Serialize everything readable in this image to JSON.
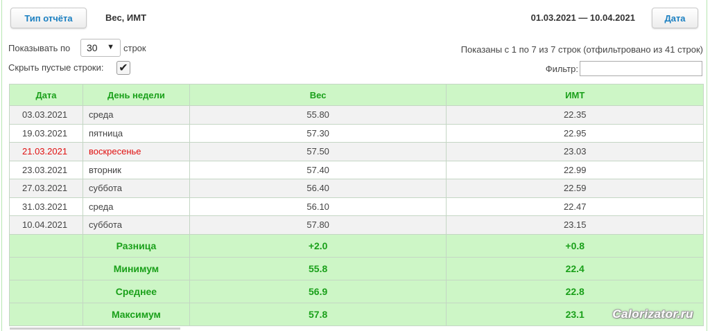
{
  "header": {
    "report_type_button": "Тип отчёта",
    "report_title": "Вес, ИМТ",
    "date_range": "01.03.2021 — 10.04.2021",
    "date_button": "Дата"
  },
  "controls": {
    "show_prefix": "Показывать по",
    "rows_per_page": "30",
    "show_suffix": "строк",
    "hide_empty_label": "Скрыть пустые строки:",
    "hide_empty_checked": "✔",
    "info_text": "Показаны с 1 по 7 из 7 строк (отфильтровано из 41 строк)",
    "filter_label": "Фильтр:",
    "filter_value": ""
  },
  "table": {
    "columns": [
      "Дата",
      "День недели",
      "Вес",
      "ИМТ"
    ],
    "rows": [
      {
        "date": "03.03.2021",
        "day": "среда",
        "weight": "55.80",
        "bmi": "22.35"
      },
      {
        "date": "19.03.2021",
        "day": "пятница",
        "weight": "57.30",
        "bmi": "22.95"
      },
      {
        "date": "21.03.2021",
        "day": "воскресенье",
        "weight": "57.50",
        "bmi": "23.03"
      },
      {
        "date": "23.03.2021",
        "day": "вторник",
        "weight": "57.40",
        "bmi": "22.99"
      },
      {
        "date": "27.03.2021",
        "day": "суббота",
        "weight": "56.40",
        "bmi": "22.59"
      },
      {
        "date": "31.03.2021",
        "day": "среда",
        "weight": "56.10",
        "bmi": "22.47"
      },
      {
        "date": "10.04.2021",
        "day": "суббота",
        "weight": "57.80",
        "bmi": "23.15"
      }
    ],
    "summary": [
      {
        "label": "Разница",
        "weight": "+2.0",
        "bmi": "+0.8"
      },
      {
        "label": "Минимум",
        "weight": "55.8",
        "bmi": "22.4"
      },
      {
        "label": "Среднее",
        "weight": "56.9",
        "bmi": "22.8"
      },
      {
        "label": "Максимум",
        "weight": "57.8",
        "bmi": "23.1"
      }
    ]
  },
  "colors": {
    "header_bg": "#cdf6c6",
    "header_text": "#1aa01a",
    "button_text": "#1a7fc1",
    "weekend_text": "#e01010"
  },
  "watermark": "Calorizator.ru"
}
